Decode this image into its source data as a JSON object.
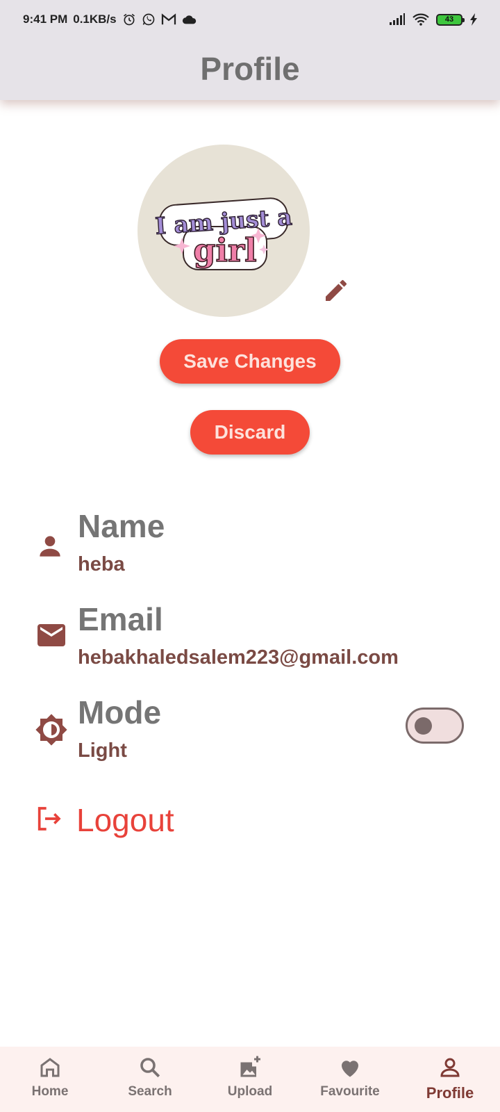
{
  "status_bar": {
    "time": "9:41 PM",
    "speed": "0.1KB/s",
    "left_icons": [
      "alarm-icon",
      "whatsapp-icon",
      "gmail-icon",
      "cloud-icon"
    ],
    "right_icons": [
      "signal-icon",
      "wifi-icon",
      "battery-icon",
      "charging-icon"
    ],
    "battery": "43"
  },
  "appbar": {
    "title": "Profile"
  },
  "avatar": {
    "sticker_lines": [
      "I am just a",
      "girl"
    ]
  },
  "actions": {
    "save_label": "Save Changes",
    "discard_label": "Discard"
  },
  "profile": {
    "name": {
      "label": "Name",
      "value": "heba",
      "icon": "person-icon"
    },
    "email": {
      "label": "Email",
      "value": "hebakhaledsalem223@gmail.com",
      "icon": "mail-icon"
    },
    "mode": {
      "label": "Mode",
      "value": "Light",
      "icon": "brightness-icon",
      "toggle_on": false
    }
  },
  "logout": {
    "label": "Logout",
    "icon": "logout-icon"
  },
  "bottom_nav": {
    "items": [
      {
        "label": "Home",
        "icon": "home-icon"
      },
      {
        "label": "Search",
        "icon": "search-icon"
      },
      {
        "label": "Upload",
        "icon": "add-photo-icon"
      },
      {
        "label": "Favourite",
        "icon": "heart-icon"
      },
      {
        "label": "Profile",
        "icon": "person-outline-icon"
      }
    ],
    "active": "Profile"
  },
  "colors": {
    "accent": "#f44a38",
    "icon_brown": "#8f4a44",
    "logout_red": "#e8423a",
    "appbar_bg": "#e6e3e8",
    "nav_bg": "#fdf1ef"
  }
}
